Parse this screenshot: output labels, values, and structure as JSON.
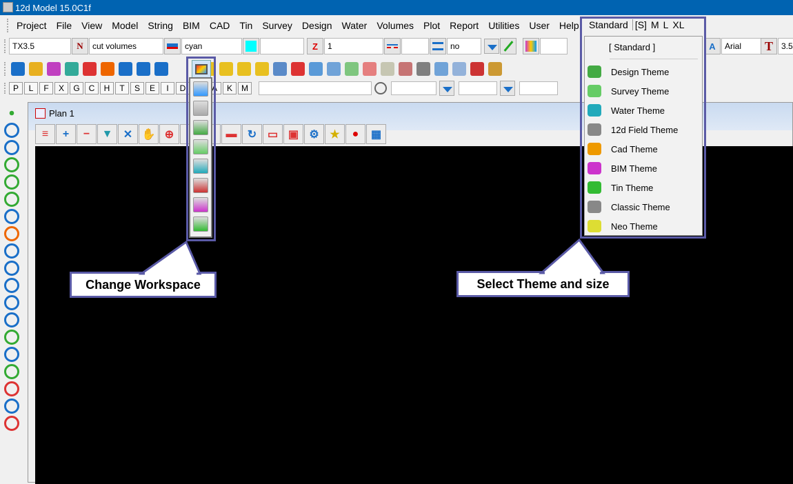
{
  "title": "12d Model  15.0C1f",
  "menu": [
    "Project",
    "File",
    "View",
    "Model",
    "String",
    "BIM",
    "CAD",
    "Tin",
    "Survey",
    "Design",
    "Water",
    "Volumes",
    "Plot",
    "Report",
    "Utilities",
    "User",
    "Help"
  ],
  "fields": {
    "text_style": "TX3.5",
    "name": "cut volumes",
    "colour": "cyan",
    "z_value": "1",
    "linestyle": "",
    "fill": "no",
    "font": "Arial",
    "text_size": "3.5"
  },
  "colors": {
    "accent": "#5a5aa6",
    "titlebar": "#0063b1",
    "swatch": "#00ffff"
  },
  "toolbar_icons": [
    "new-icon",
    "open-folder-icon",
    "save-icon",
    "globe-icon",
    "import-icon",
    "export-icon",
    "undo-icon",
    "redo-icon",
    "settings-icon",
    "workspace-icon",
    "folder-search-icon",
    "folder-1-icon",
    "folder-2-icon",
    "folder-3-icon",
    "model-icon",
    "calendar-icon",
    "tag-icon",
    "user-icon",
    "image-icon",
    "layers-icon",
    "shell-icon",
    "function-icon",
    "check-icon",
    "share-icon",
    "wrench-icon",
    "fx-icon",
    "fx2-icon"
  ],
  "letter_buttons": [
    "P",
    "L",
    "F",
    "X",
    "G",
    "C",
    "H",
    "T",
    "S",
    "E",
    "I",
    "D",
    "",
    "A",
    "K",
    "M"
  ],
  "plan": {
    "title": "Plan 1",
    "toolbar": [
      "menu-icon",
      "zoom-in-plus-icon",
      "zoom-out-minus-icon",
      "funnel-icon",
      "fit-icon",
      "pan-hand-icon",
      "zoom-icon",
      "",
      "",
      "toggle-icon",
      "refresh-icon",
      "print-icon",
      "copy-icon",
      "gear-icon",
      "star-icon",
      "pin-icon",
      "grid-icon"
    ]
  },
  "workspace_items": [
    "standard-workspace-icon",
    "classic-workspace-icon",
    "design-workspace-icon",
    "survey-workspace-icon",
    "water-workspace-icon",
    "cad-workspace-icon",
    "bim-workspace-icon",
    "tin-workspace-icon"
  ],
  "theme_header": {
    "current": "Standard",
    "sizes": [
      "[S]",
      "M",
      "L",
      "XL"
    ]
  },
  "theme_menu": {
    "selected": "[ Standard ]",
    "items": [
      "Design Theme",
      "Survey Theme",
      "Water Theme",
      "12d Field Theme",
      "Cad Theme",
      "BIM Theme",
      "Tin Theme",
      "Classic Theme",
      "Neo Theme"
    ]
  },
  "callouts": {
    "workspace": "Change Workspace",
    "theme": "Select Theme and size"
  }
}
